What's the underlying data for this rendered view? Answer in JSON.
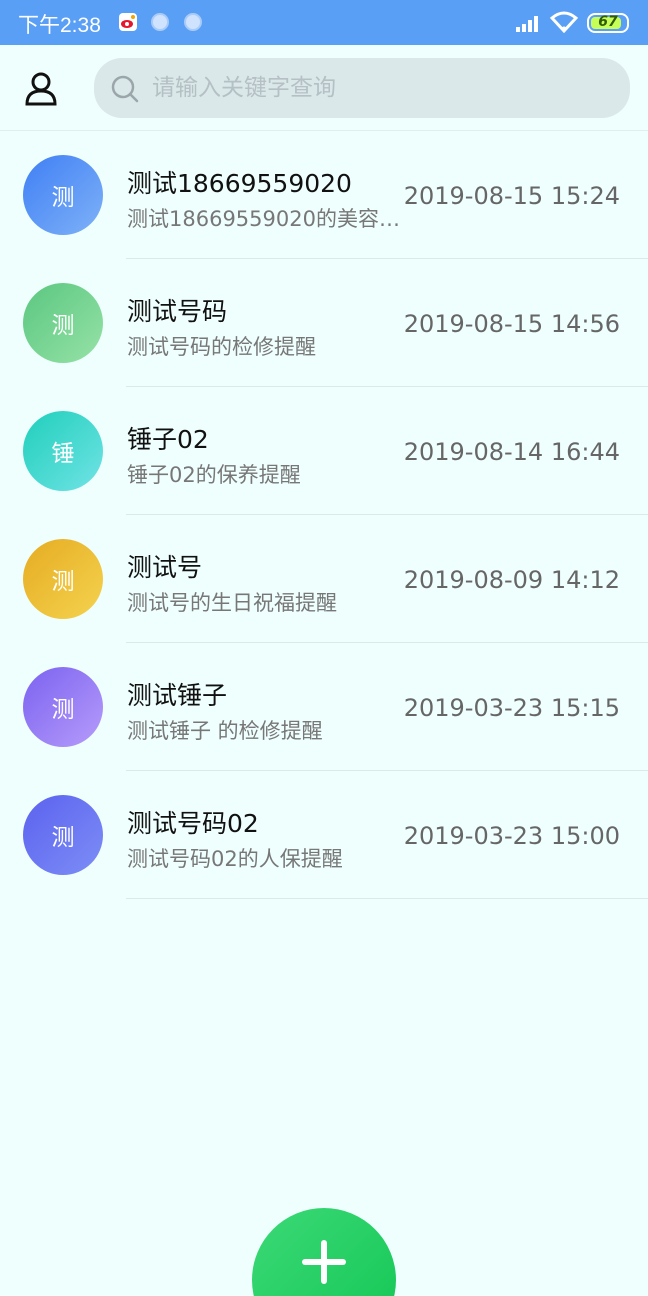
{
  "status_bar": {
    "time": "下午2:38",
    "icons": [
      "weibo-icon",
      "circle-icon",
      "circle-icon"
    ],
    "battery": "67"
  },
  "header": {
    "search": {
      "placeholder": "请输入关键字查询",
      "value": ""
    }
  },
  "list": [
    {
      "avatar_text": "测",
      "title": "测试18669559020",
      "subtitle": "测试18669559020的美容…",
      "time": "2019-08-15 15:24",
      "colors": [
        "#3f7ff4",
        "#7fb2f8"
      ]
    },
    {
      "avatar_text": "测",
      "title": "测试号码",
      "subtitle": "测试号码的检修提醒",
      "time": "2019-08-15 14:56",
      "colors": [
        "#5ac77f",
        "#96e2a7"
      ]
    },
    {
      "avatar_text": "锤",
      "title": "锤子02",
      "subtitle": "锤子02的保养提醒",
      "time": "2019-08-14 16:44",
      "colors": [
        "#1fcfbb",
        "#71e3e6"
      ]
    },
    {
      "avatar_text": "测",
      "title": "测试号",
      "subtitle": "测试号的生日祝福提醒",
      "time": "2019-08-09 14:12",
      "colors": [
        "#e5ac22",
        "#f5d34f"
      ]
    },
    {
      "avatar_text": "测",
      "title": "测试锤子",
      "subtitle": "测试锤子 的检修提醒",
      "time": "2019-03-23 15:15",
      "colors": [
        "#7b62f0",
        "#b69cfa"
      ]
    },
    {
      "avatar_text": "测",
      "title": "测试号码02",
      "subtitle": "测试号码02的人保提醒",
      "time": "2019-03-23 15:00",
      "colors": [
        "#5b62ef",
        "#7d8ef6"
      ]
    }
  ],
  "fab": {
    "icon": "plus-icon"
  }
}
